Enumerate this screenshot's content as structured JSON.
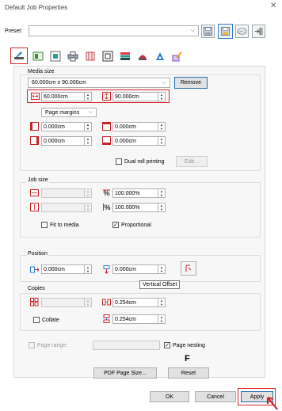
{
  "window": {
    "title": "Default Job Properties",
    "close": "✕"
  },
  "preset": {
    "label": "Preset:",
    "value": ""
  },
  "preset_toolbar": [
    "save-preset",
    "save-as-preset",
    "rename-preset",
    "import-preset"
  ],
  "tabs": [
    "media-size",
    "layout",
    "color-management",
    "printer",
    "marks",
    "cut",
    "color-adjust",
    "color-replacement",
    "spot-color",
    "variable-data"
  ],
  "media_size": {
    "title": "Media size",
    "media_value": "60.000cm x 90.000cm",
    "remove_label": "Remove",
    "width": "60.000cm",
    "height": "90.000cm",
    "margins_combo": "Page margins",
    "margin_left": "0.000cm",
    "margin_top": "0.000cm",
    "margin_right": "0.000cm",
    "margin_bottom": "0.000cm",
    "dual_roll_label": "Dual roll printing",
    "edit_label": "Edit..."
  },
  "job_size": {
    "title": "Job size",
    "width": "",
    "height": "",
    "scale_x": "100.000%",
    "scale_y": "100.000%",
    "fit_label": "Fit to media",
    "proportional_label": "Proportional",
    "proportional_checked": true
  },
  "position": {
    "title": "Position",
    "x": "0.000cm",
    "y": "0.000cm",
    "tooltip": "Vertical Offset"
  },
  "copies": {
    "title": "Copies",
    "count": "",
    "gap_h": "0.254cm",
    "gap_v": "0.254cm",
    "collate_label": "Collate"
  },
  "page_range": {
    "label": "Page range:",
    "value": ""
  },
  "page_nesting": {
    "label": "Page nesting",
    "checked": true
  },
  "marker_letter": "F",
  "buttons": {
    "pdf_page_size": "PDF Page Size...",
    "reset": "Reset",
    "ok": "OK",
    "cancel": "Cancel",
    "apply": "Apply"
  },
  "colors": {
    "highlight": "#d8232a",
    "accent": "#1f6fb5"
  }
}
